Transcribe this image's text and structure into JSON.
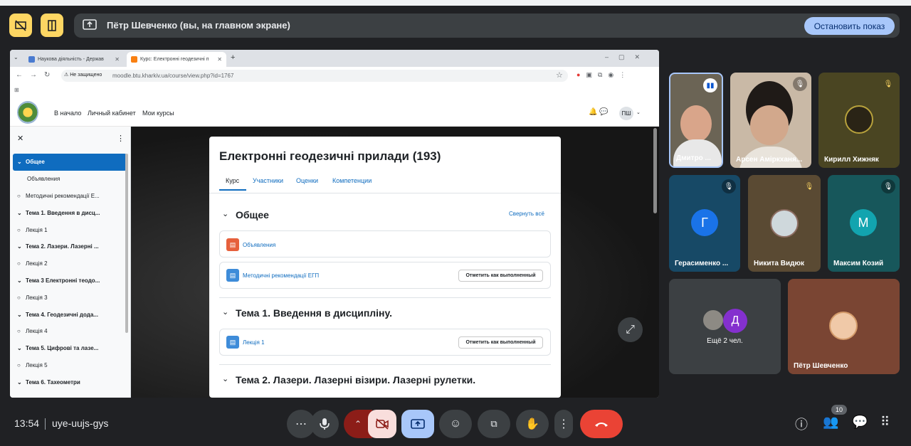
{
  "presentation": {
    "text": "Пётр Шевченко (вы, на главном экране)",
    "stop_label": "Остановить показ"
  },
  "browser": {
    "tabs": [
      {
        "label": "Наукова діяльність - Держав"
      },
      {
        "label": "Курс: Електронні геодезичні п"
      }
    ],
    "security_label": "Не защищено",
    "url": "moodle.btu.kharkiv.ua/course/view.php?id=1767"
  },
  "moodle": {
    "nav": [
      "В начало",
      "Личный кабинет",
      "Мои курсы"
    ],
    "user_initials": "ПШ",
    "course_index": [
      {
        "label": "Общее",
        "type": "section",
        "active": true
      },
      {
        "label": "Объявления",
        "type": "item"
      },
      {
        "label": "Методичні рекомендації Е...",
        "type": "activity"
      },
      {
        "label": "Тема 1. Введення в дисц...",
        "type": "section"
      },
      {
        "label": "Лекція 1",
        "type": "activity"
      },
      {
        "label": "Тема 2. Лазери. Лазерні ...",
        "type": "section"
      },
      {
        "label": "Лекція 2",
        "type": "activity"
      },
      {
        "label": "Тема 3 Електронні теодо...",
        "type": "section"
      },
      {
        "label": "Лекція 3",
        "type": "activity"
      },
      {
        "label": "Тема 4. Геодезичні дода...",
        "type": "section"
      },
      {
        "label": "Лекція 4",
        "type": "activity"
      },
      {
        "label": "Тема 5. Цифрові та лазе...",
        "type": "section"
      },
      {
        "label": "Лекція 5",
        "type": "activity"
      },
      {
        "label": "Тема 6. Тахеометри",
        "type": "section"
      }
    ],
    "course": {
      "title": "Електронні геодезичні прилади (193)",
      "tabs": [
        "Курс",
        "Участники",
        "Оценки",
        "Компетенции"
      ],
      "collapse_all": "Свернуть всё",
      "mark_done": "Отметить как выполненный",
      "sections": [
        {
          "title": "Общее",
          "activities": [
            "Объявления",
            "Методичні рекомендації ЕГП"
          ]
        },
        {
          "title": "Тема 1. Введення в дисципліну.",
          "activities": [
            "Лекція 1"
          ]
        },
        {
          "title": "Тема 2. Лазери. Лазерні візири. Лазерні рулетки."
        }
      ]
    }
  },
  "participants": [
    {
      "name": "Дмитро ..."
    },
    {
      "name": "Арсен Аміркханя..."
    },
    {
      "name": "Кирилл Хижняк"
    },
    {
      "name": "Герасименко ...",
      "letter": "Г"
    },
    {
      "name": "Никита Видюк"
    },
    {
      "name": "Максим Козий",
      "letter": "M"
    },
    {
      "name": "Ещё 2 чел.",
      "letter": "Д"
    },
    {
      "name": "Пётр Шевченко"
    }
  ],
  "bottom": {
    "time": "13:54",
    "meeting_code": "uye-uujs-gys",
    "participant_count": "10"
  },
  "colors": {
    "accent_yellow": "#fdd663",
    "stop_button": "#a8c7fa",
    "moodle_blue": "#0f6cbf",
    "hangup_red": "#ea4335"
  }
}
